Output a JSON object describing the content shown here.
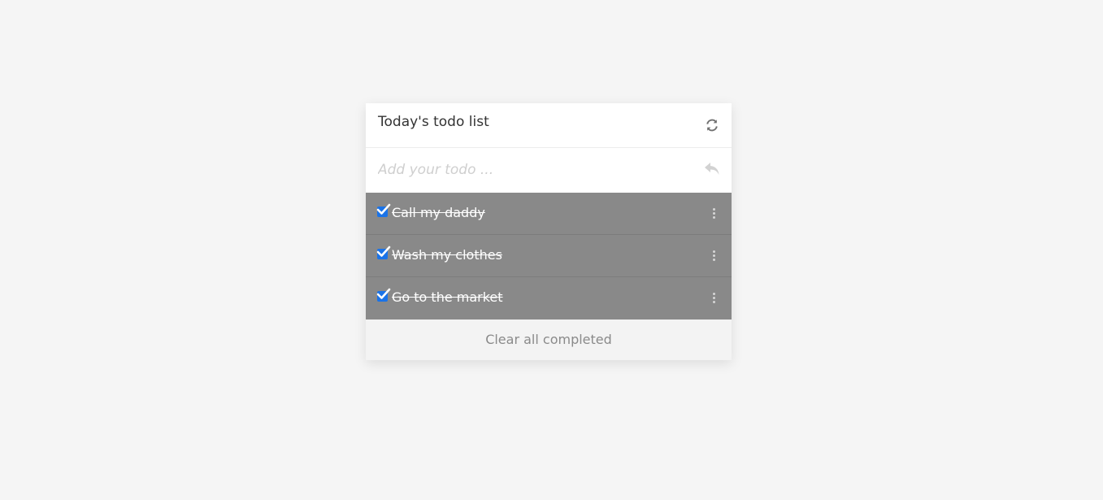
{
  "header": {
    "title": "Today's todo list",
    "refresh_icon": "refresh-icon"
  },
  "input": {
    "placeholder": "Add your todo ...",
    "value": "",
    "submit_icon": "reply-icon"
  },
  "todos": [
    {
      "text": "Call my daddy",
      "completed": true
    },
    {
      "text": "Wash my clothes",
      "completed": true
    },
    {
      "text": "Go to the market",
      "completed": true
    }
  ],
  "footer": {
    "clear_label": "Clear all completed"
  },
  "colors": {
    "background": "#f5f5f5",
    "completed_row": "#898989",
    "checkbox": "#1a73e8",
    "footer": "#f3f3f3"
  }
}
